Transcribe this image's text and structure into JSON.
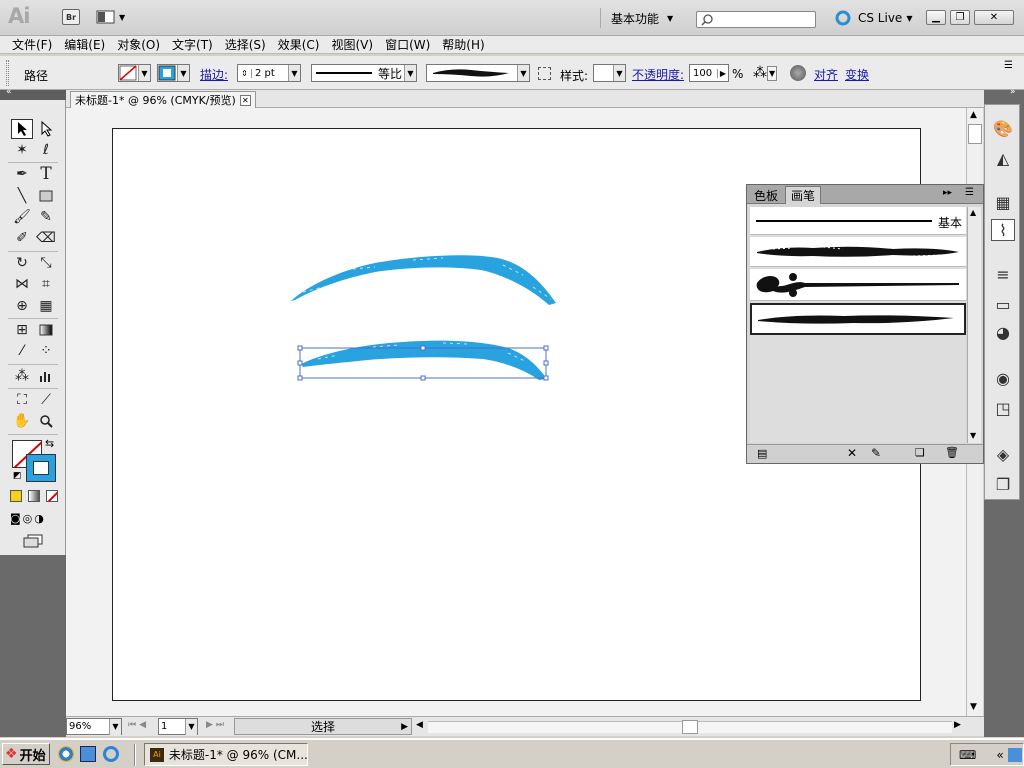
{
  "app": {
    "logo": "Ai",
    "bridge_label": "Br",
    "workspace": "基本功能",
    "cs_live": "CS Live",
    "search_placeholder": ""
  },
  "menu": [
    "文件(F)",
    "编辑(E)",
    "对象(O)",
    "文字(T)",
    "选择(S)",
    "效果(C)",
    "视图(V)",
    "窗口(W)",
    "帮助(H)"
  ],
  "control": {
    "object_type": "路径",
    "stroke_label": "描边:",
    "stroke_weight": "2 pt",
    "profile": "等比",
    "style_label": "样式:",
    "opacity_label": "不透明度:",
    "opacity_value": "100",
    "opacity_unit": "%",
    "align_link": "对齐",
    "transform_link": "变换"
  },
  "document": {
    "tab_title": "未标题-1* @ 96% (CMYK/预览)",
    "zoom": "96%",
    "artboard_number": "1",
    "status": "选择"
  },
  "brushes_panel": {
    "tabs": [
      "色板",
      "画笔"
    ],
    "active_tab": "画笔",
    "brushes": [
      {
        "name": "基本"
      },
      {
        "name": ""
      },
      {
        "name": ""
      },
      {
        "name": ""
      }
    ]
  },
  "colors": {
    "stroke_blue": "#29a3df",
    "selection_blue": "#4a6fd0",
    "panel_gray": "#6a6a6a"
  },
  "taskbar": {
    "start": "开始",
    "task_title": "未标题-1* @ 96% (CM..."
  }
}
